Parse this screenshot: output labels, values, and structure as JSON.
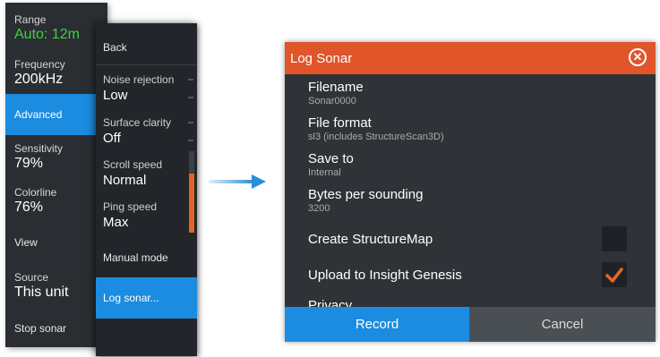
{
  "sidebar": {
    "range": {
      "label": "Range",
      "value": "Auto: 12m"
    },
    "frequency": {
      "label": "Frequency",
      "value": "200kHz"
    },
    "advanced": "Advanced",
    "sensitivity": {
      "label": "Sensitivity",
      "value": "79%"
    },
    "colorline": {
      "label": "Colorline",
      "value": "76%"
    },
    "view": "View",
    "source": {
      "label": "Source",
      "value": "This unit"
    },
    "stop_sonar": "Stop sonar"
  },
  "submenu": {
    "back": "Back",
    "noise_rejection": {
      "label": "Noise rejection",
      "value": "Low"
    },
    "surface_clarity": {
      "label": "Surface clarity",
      "value": "Off"
    },
    "scroll_speed": {
      "label": "Scroll speed",
      "value": "Normal"
    },
    "ping_speed": {
      "label": "Ping speed",
      "value": "Max"
    },
    "manual_mode": "Manual mode",
    "log_sonar": "Log sonar..."
  },
  "dialog": {
    "title": "Log Sonar",
    "filename": {
      "label": "Filename",
      "value": "Sonar0000"
    },
    "file_format": {
      "label": "File format",
      "value": "sl3 (includes StructureScan3D)"
    },
    "save_to": {
      "label": "Save to",
      "value": "Internal"
    },
    "bytes_per_sounding": {
      "label": "Bytes per sounding",
      "value": "3200"
    },
    "create_structuremap": {
      "label": "Create StructureMap",
      "checked": false
    },
    "upload_insight": {
      "label": "Upload to Insight Genesis",
      "checked": true
    },
    "privacy": {
      "label": "Privacy"
    },
    "record_label": "Record",
    "cancel_label": "Cancel"
  },
  "colors": {
    "accent_blue": "#1b8ce0",
    "title_orange": "#e0552a",
    "range_value_green": "#3fd33f",
    "check_orange": "#e8642a"
  },
  "icons": {
    "close": "close-circle-icon",
    "check": "checkmark-icon",
    "arrow": "right-arrow-icon"
  }
}
